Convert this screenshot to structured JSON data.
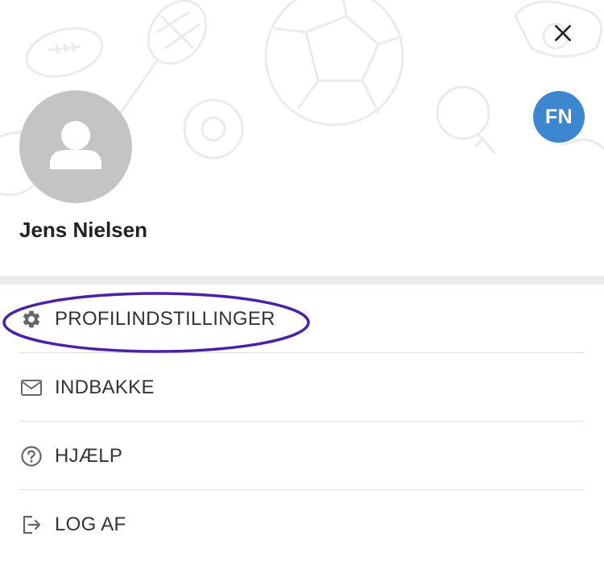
{
  "header": {
    "close_icon": "close-icon",
    "user_name": "Jens Nielsen",
    "avatar_icon": "person-icon",
    "initials": "FN",
    "initials_color": "#3d87d0"
  },
  "menu": {
    "items": [
      {
        "label": "PROFILINDSTILLINGER",
        "icon": "gear-icon",
        "highlighted": true
      },
      {
        "label": "INDBAKKE",
        "icon": "mail-icon"
      },
      {
        "label": "HJÆLP",
        "icon": "help-icon"
      },
      {
        "label": "LOG AF",
        "icon": "logout-icon"
      }
    ],
    "highlight_color": "#4a22a8"
  }
}
